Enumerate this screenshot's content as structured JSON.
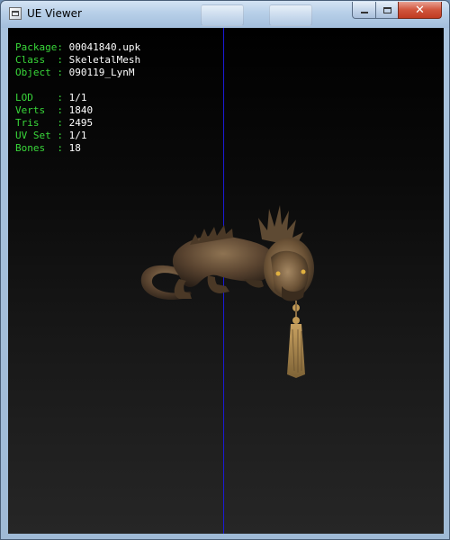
{
  "window": {
    "title": "UE Viewer",
    "controls": {
      "minimize": "minimize-icon",
      "maximize": "maximize-icon",
      "close": "close-icon"
    }
  },
  "info": {
    "package": {
      "label": "Package: ",
      "value": "00041840.upk"
    },
    "class": {
      "label": "Class  : ",
      "value": "SkeletalMesh"
    },
    "object": {
      "label": "Object : ",
      "value": "090119_LynM"
    },
    "lod": {
      "label": "LOD    : ",
      "value": "1/1"
    },
    "verts": {
      "label": "Verts  : ",
      "value": "1840"
    },
    "tris": {
      "label": "Tris   : ",
      "value": "2495"
    },
    "uvset": {
      "label": "UV Set : ",
      "value": "1/1"
    },
    "bones": {
      "label": "Bones  : ",
      "value": "18"
    }
  },
  "colors": {
    "label_green": "#39d83a",
    "value_white": "#ffffff",
    "axis_blue": "#1a1ad8",
    "model_bronze": "#6b5236"
  },
  "model": {
    "icon": "dragon-lion-mesh-icon"
  }
}
